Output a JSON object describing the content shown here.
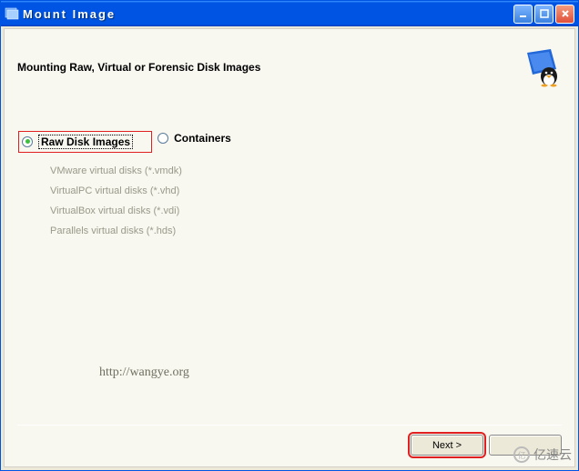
{
  "window": {
    "title": "Mount Image"
  },
  "heading": "Mounting Raw, Virtual or Forensic Disk Images",
  "options": {
    "raw": {
      "label": "Raw Disk Images",
      "selected": true
    },
    "containers": {
      "label": "Containers",
      "selected": false
    },
    "containers_list": [
      "VMware virtual disks (*.vmdk)",
      "VirtualPC virtual disks (*.vhd)",
      "VirtualBox virtual disks (*.vdi)",
      "Parallels virtual disks (*.hds)"
    ]
  },
  "watermark_url": "http://wangye.org",
  "buttons": {
    "next": "Next >"
  },
  "corner_watermark": "亿速云"
}
